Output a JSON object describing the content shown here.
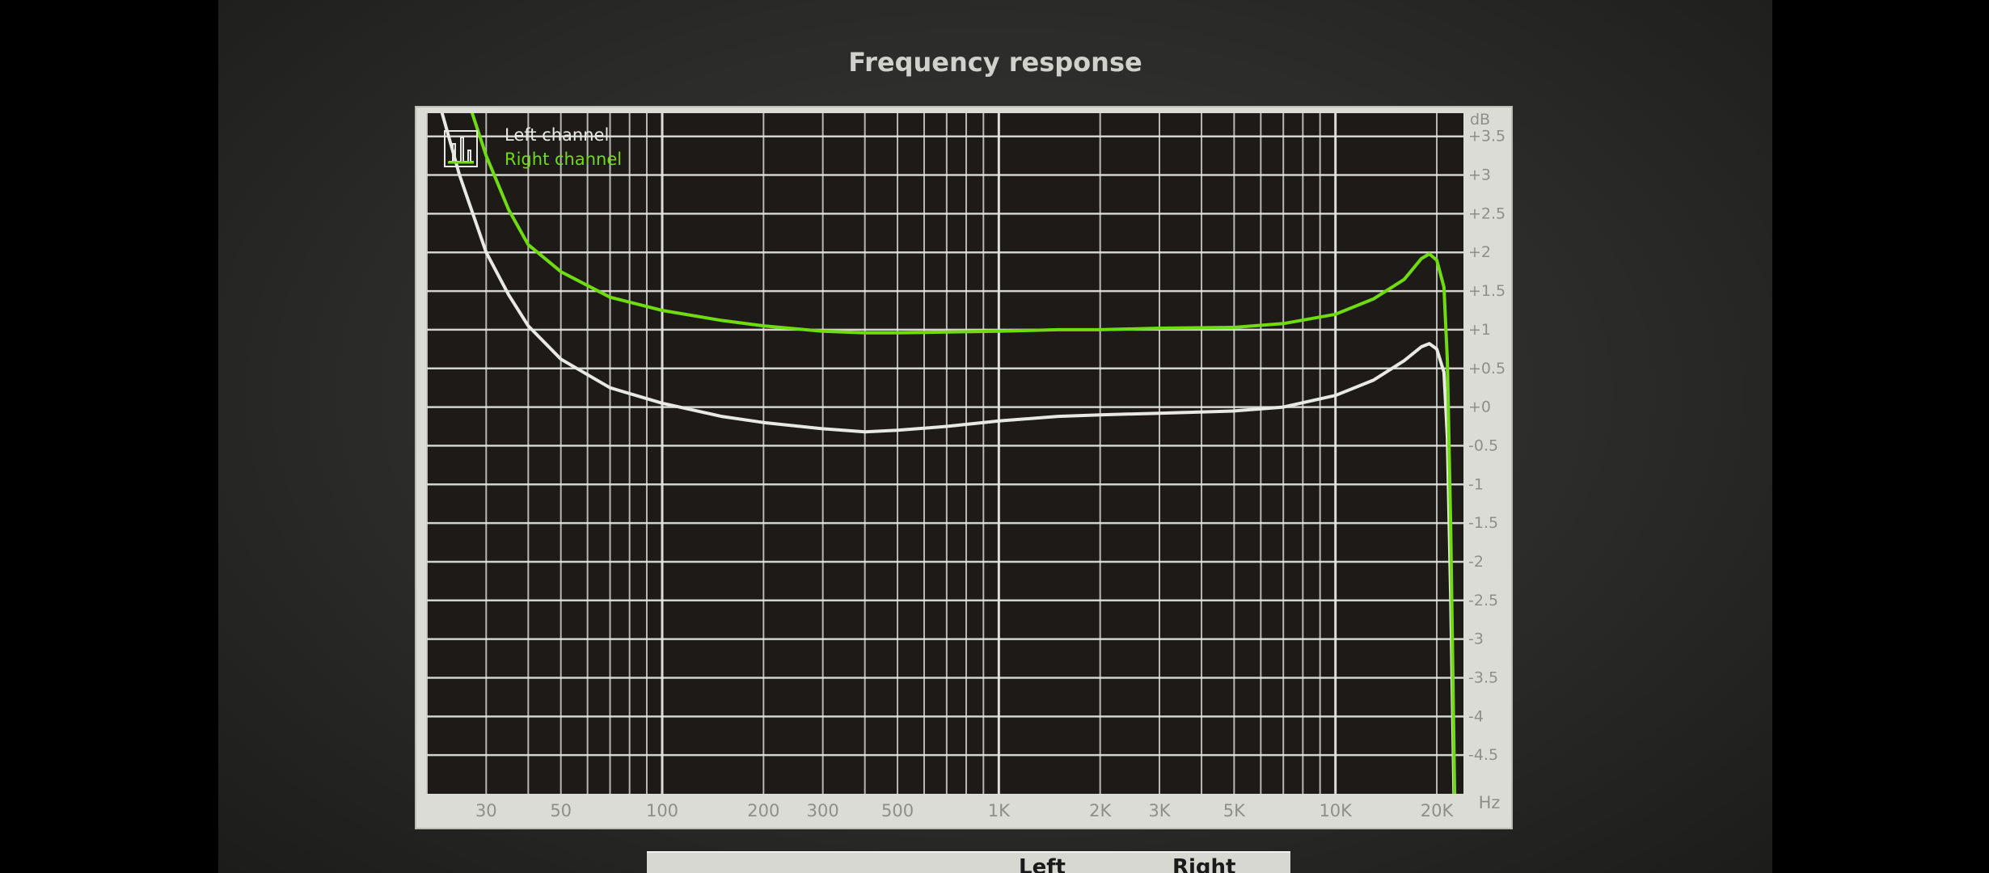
{
  "chart_data": {
    "type": "line",
    "title": "Frequency response",
    "x_unit": "Hz",
    "y_unit": "dB",
    "x_scale": "log",
    "xlim": [
      20,
      24000
    ],
    "ylim": [
      -5,
      3.8
    ],
    "grid": true,
    "legend_position": "top-left",
    "x_ticks": [
      {
        "value": 30,
        "label": "30"
      },
      {
        "value": 50,
        "label": "50"
      },
      {
        "value": 100,
        "label": "100"
      },
      {
        "value": 200,
        "label": "200"
      },
      {
        "value": 300,
        "label": "300"
      },
      {
        "value": 500,
        "label": "500"
      },
      {
        "value": 1000,
        "label": "1K"
      },
      {
        "value": 2000,
        "label": "2K"
      },
      {
        "value": 3000,
        "label": "3K"
      },
      {
        "value": 5000,
        "label": "5K"
      },
      {
        "value": 10000,
        "label": "10K"
      },
      {
        "value": 20000,
        "label": "20K"
      }
    ],
    "y_ticks": [
      {
        "value": 3.5,
        "label": "+3.5"
      },
      {
        "value": 3,
        "label": "+3"
      },
      {
        "value": 2.5,
        "label": "+2.5"
      },
      {
        "value": 2,
        "label": "+2"
      },
      {
        "value": 1.5,
        "label": "+1.5"
      },
      {
        "value": 1,
        "label": "+1"
      },
      {
        "value": 0.5,
        "label": "+0.5"
      },
      {
        "value": 0,
        "label": "+0"
      },
      {
        "value": -0.5,
        "label": "-0.5"
      },
      {
        "value": -1,
        "label": "-1"
      },
      {
        "value": -1.5,
        "label": "-1.5"
      },
      {
        "value": -2,
        "label": "-2"
      },
      {
        "value": -2.5,
        "label": "-2.5"
      },
      {
        "value": -3,
        "label": "-3"
      },
      {
        "value": -3.5,
        "label": "-3.5"
      },
      {
        "value": -4,
        "label": "-4"
      },
      {
        "value": -4.5,
        "label": "-4.5"
      }
    ],
    "series": [
      {
        "name": "Left channel",
        "color": "#e8e8e4",
        "points": [
          [
            20,
            4.5
          ],
          [
            25,
            3.0
          ],
          [
            30,
            2.0
          ],
          [
            35,
            1.45
          ],
          [
            40,
            1.05
          ],
          [
            50,
            0.62
          ],
          [
            70,
            0.25
          ],
          [
            100,
            0.05
          ],
          [
            150,
            -0.12
          ],
          [
            200,
            -0.2
          ],
          [
            300,
            -0.28
          ],
          [
            400,
            -0.32
          ],
          [
            500,
            -0.3
          ],
          [
            700,
            -0.25
          ],
          [
            1000,
            -0.18
          ],
          [
            1500,
            -0.12
          ],
          [
            2000,
            -0.1
          ],
          [
            3000,
            -0.08
          ],
          [
            5000,
            -0.05
          ],
          [
            7000,
            0.0
          ],
          [
            10000,
            0.15
          ],
          [
            13000,
            0.35
          ],
          [
            16000,
            0.6
          ],
          [
            18000,
            0.78
          ],
          [
            19000,
            0.82
          ],
          [
            20000,
            0.75
          ],
          [
            21000,
            0.45
          ],
          [
            21500,
            -0.4
          ],
          [
            22000,
            -2.5
          ],
          [
            22500,
            -5.0
          ]
        ]
      },
      {
        "name": "Right channel",
        "color": "#6fdc10",
        "points": [
          [
            20,
            6.2
          ],
          [
            25,
            4.3
          ],
          [
            30,
            3.25
          ],
          [
            35,
            2.55
          ],
          [
            40,
            2.1
          ],
          [
            50,
            1.75
          ],
          [
            70,
            1.42
          ],
          [
            100,
            1.25
          ],
          [
            150,
            1.12
          ],
          [
            200,
            1.05
          ],
          [
            300,
            0.98
          ],
          [
            400,
            0.96
          ],
          [
            500,
            0.96
          ],
          [
            700,
            0.97
          ],
          [
            1000,
            0.98
          ],
          [
            1500,
            1.0
          ],
          [
            2000,
            1.0
          ],
          [
            3000,
            1.02
          ],
          [
            5000,
            1.03
          ],
          [
            7000,
            1.08
          ],
          [
            10000,
            1.2
          ],
          [
            13000,
            1.4
          ],
          [
            16000,
            1.65
          ],
          [
            18000,
            1.92
          ],
          [
            19000,
            1.98
          ],
          [
            20000,
            1.9
          ],
          [
            21000,
            1.55
          ],
          [
            21500,
            0.6
          ],
          [
            22000,
            -1.6
          ],
          [
            22600,
            -5.0
          ]
        ]
      }
    ]
  },
  "bottom_table": {
    "headers": [
      "Left",
      "Right"
    ]
  }
}
